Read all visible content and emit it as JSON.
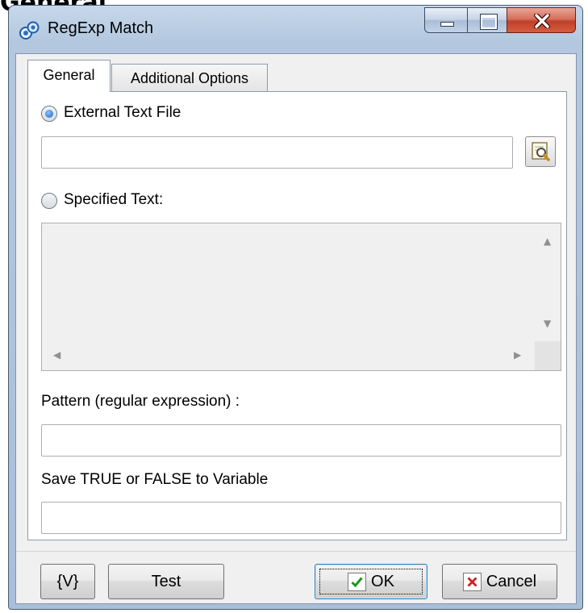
{
  "page": {
    "heading": "General"
  },
  "window": {
    "title": "RegExp Match",
    "controls": {
      "minimize": "minimize",
      "maximize": "maximize",
      "close": "close"
    }
  },
  "tabs": [
    {
      "label": "General",
      "selected": true
    },
    {
      "label": "Additional Options",
      "selected": false
    }
  ],
  "general": {
    "source_options": [
      {
        "label": "External Text File",
        "checked": true
      },
      {
        "label": "Specified Text:",
        "checked": false
      }
    ],
    "file_path": {
      "value": ""
    },
    "specified_text": {
      "value": "",
      "enabled": false
    },
    "pattern": {
      "label": "Pattern (regular expression) :",
      "value": ""
    },
    "save_variable": {
      "label": "Save TRUE or FALSE to Variable",
      "value": ""
    }
  },
  "footer": {
    "variable_button": "{V}",
    "test_button": "Test",
    "ok_button": "OK",
    "cancel_button": "Cancel"
  },
  "colors": {
    "title_bar": "#b3c8df",
    "dialog_background": "#f0f0f0",
    "ok_icon": "#1a9a1a",
    "cancel_icon": "#d21f1f"
  },
  "icons": {
    "app": "regexp-app-icon",
    "browse": "browse-file-icon",
    "ok": "checkmark-icon",
    "cancel": "x-mark-icon"
  }
}
